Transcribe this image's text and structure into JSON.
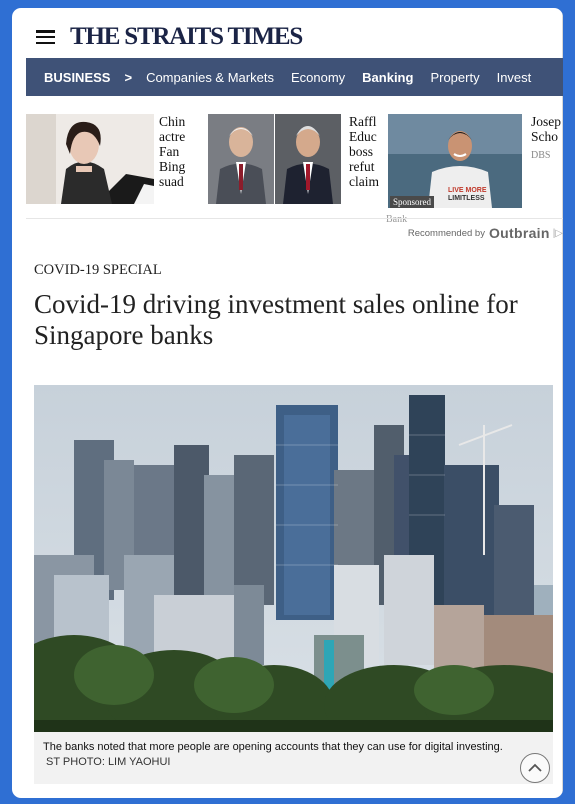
{
  "masthead": {
    "logo_text": "THE STRAITS TIMES",
    "menu_icon": "hamburger-icon"
  },
  "section_nav": {
    "section": "BUSINESS",
    "chevron": ">",
    "items": [
      {
        "label": "Companies & Markets",
        "active": false
      },
      {
        "label": "Economy",
        "active": false
      },
      {
        "label": "Banking",
        "active": true
      },
      {
        "label": "Property",
        "active": false
      },
      {
        "label": "Invest",
        "active": false
      }
    ]
  },
  "promos": [
    {
      "lines": [
        "Chin",
        "actre",
        "Fan",
        "Bing",
        "suad"
      ]
    },
    {
      "lines": [
        "Raffl",
        "Educ",
        "boss",
        "refut",
        "claim"
      ]
    },
    {
      "lines": [
        "Josep",
        "Scho"
      ],
      "source": "DBS",
      "badge": "Sponsored",
      "sublabel": "Bank"
    }
  ],
  "recommended": {
    "prefix": "Recommended by",
    "brand": "Outbrain",
    "ad_mark": "|▷"
  },
  "article": {
    "kicker": "COVID-19 SPECIAL",
    "headline": "Covid-19 driving investment sales online for Singapore banks",
    "caption": "The banks noted that more people are opening accounts that they can use for digital investing.",
    "credit": "ST PHOTO: LIM YAOHUI"
  },
  "colors": {
    "browser_frame": "#2f6fd3",
    "nav_bg": "#3f5277",
    "logo": "#1b2446"
  }
}
